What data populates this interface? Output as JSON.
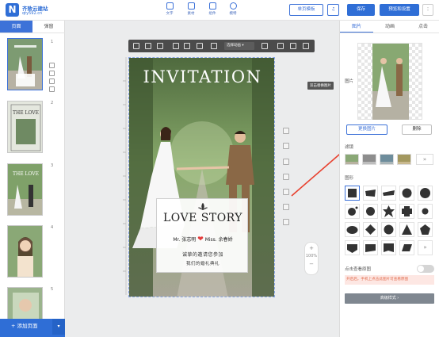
{
  "header": {
    "logo_mark": "N",
    "logo_name": "齐致云建站",
    "logo_url": "qty592.cn",
    "tools": [
      {
        "label": "文字",
        "icon": "text-icon"
      },
      {
        "label": "素材",
        "icon": "image-icon"
      },
      {
        "label": "组件",
        "icon": "component-icon"
      },
      {
        "label": "模特",
        "icon": "model-icon"
      }
    ],
    "single_page_template": "单页模板",
    "music_label": "♫",
    "save": "保存",
    "preview_settings": "预览和设置",
    "more": "⋮"
  },
  "left_panel": {
    "tabs": [
      "页面",
      "弹窗"
    ],
    "pages": [
      "1",
      "2",
      "3",
      "4",
      "5"
    ],
    "add_page": "+ 添加页面",
    "add_caret": "▾",
    "thumb2_title": "THE LOVE",
    "thumb3_title": "THE LOVE"
  },
  "canvas": {
    "toolbar_select": "选择动画 ▾",
    "tooltip": "双击替换图片",
    "zoom_plus": "+",
    "zoom_level": "100%",
    "zoom_minus": "−",
    "invitation_title": "INVITATION",
    "love_story": "LOVE STORY",
    "groom": "Mr. 张志明",
    "bride": "Miss. 余春娇",
    "heart": "❤",
    "line1": "诚挚的邀请您参加",
    "line2": "我们的婚礼典礼"
  },
  "right_panel": {
    "tabs": [
      "图片",
      "动画",
      "点击"
    ],
    "image_label": "图片",
    "change_image": "更换图片",
    "delete": "删除",
    "filter_label": "滤镜",
    "filter_more": "»",
    "shape_label": "图形",
    "shape_more": "»",
    "click_view_label": "点击查看原图",
    "note": "开启后，手机上点击此图片可查看原图",
    "more_styles": "高级样式 ›"
  },
  "colors": {
    "accent": "#3d72d8",
    "arrow": "#e8412f",
    "note_bg": "#fde7e3"
  }
}
